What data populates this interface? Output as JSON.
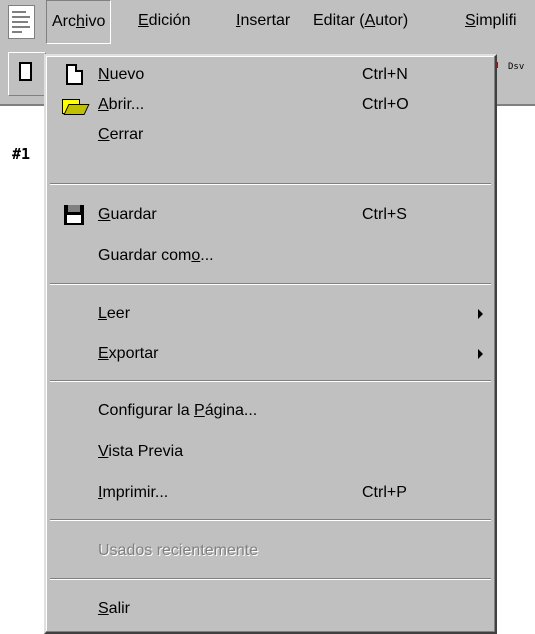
{
  "menubar": {
    "items": [
      {
        "label": "Archivo",
        "pre": "Arc",
        "mn": "h",
        "post": "ivo"
      },
      {
        "label": "Edición",
        "pre": "",
        "mn": "E",
        "post": "dición"
      },
      {
        "label": "Insertar",
        "pre": "",
        "mn": "I",
        "post": "nsertar"
      },
      {
        "label": "Editar (Autor)",
        "pre": "Editar (",
        "mn": "A",
        "post": "utor)"
      },
      {
        "label": "Simplificar",
        "pre": "",
        "mn": "S",
        "post": "implifi"
      }
    ]
  },
  "document": {
    "label": "#1"
  },
  "toolbar": {
    "small_text": "Dsv"
  },
  "menu": {
    "items": [
      {
        "pre": "",
        "mn": "N",
        "post": "uevo",
        "shortcut": "Ctrl+N",
        "icon": "new-page-icon"
      },
      {
        "pre": "",
        "mn": "A",
        "post": "brir...",
        "shortcut": "Ctrl+O",
        "icon": "open-folder-icon"
      },
      {
        "pre": "",
        "mn": "C",
        "post": "errar",
        "shortcut": ""
      },
      {
        "pre": "",
        "mn": "G",
        "post": "uardar",
        "shortcut": "Ctrl+S",
        "icon": "floppy-disk-icon"
      },
      {
        "pre": "Guardar com",
        "mn": "o",
        "post": "...",
        "shortcut": ""
      },
      {
        "pre": "",
        "mn": "L",
        "post": "eer",
        "shortcut": "",
        "submenu": true
      },
      {
        "pre": "",
        "mn": "E",
        "post": "xportar",
        "shortcut": "",
        "submenu": true
      },
      {
        "pre": "Configurar la ",
        "mn": "P",
        "post": "ágina...",
        "shortcut": ""
      },
      {
        "pre": "",
        "mn": "V",
        "post": "ista Previa",
        "shortcut": ""
      },
      {
        "pre": "",
        "mn": "I",
        "post": "mprimir...",
        "shortcut": "Ctrl+P"
      },
      {
        "pre": "Usados recientemente",
        "mn": "",
        "post": "",
        "shortcut": "",
        "disabled": true
      },
      {
        "pre": "",
        "mn": "S",
        "post": "alir",
        "shortcut": ""
      }
    ]
  },
  "colors": {
    "face": "#c0c0c0",
    "shadow": "#808080",
    "highlight": "#ffffff"
  }
}
